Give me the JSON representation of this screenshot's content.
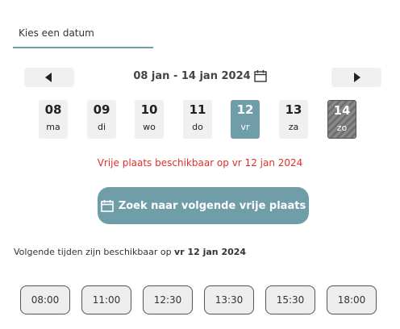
{
  "tab": {
    "label": "Kies een datum"
  },
  "week": {
    "range": "08 jan - 14 jan 2024"
  },
  "days": [
    {
      "num": "08",
      "weekday": "ma",
      "state": "normal"
    },
    {
      "num": "09",
      "weekday": "di",
      "state": "normal"
    },
    {
      "num": "10",
      "weekday": "wo",
      "state": "normal"
    },
    {
      "num": "11",
      "weekday": "do",
      "state": "normal"
    },
    {
      "num": "12",
      "weekday": "vr",
      "state": "selected"
    },
    {
      "num": "13",
      "weekday": "za",
      "state": "normal"
    },
    {
      "num": "14",
      "weekday": "zo",
      "state": "disabled"
    }
  ],
  "availability_message": "Vrije plaats beschikbaar op vr 12 jan 2024",
  "search_button": {
    "label": "Zoek naar volgende vrije plaats"
  },
  "next_times": {
    "prefix": "Volgende tijden zijn beschikbaar op ",
    "date": "vr 12 jan 2024"
  },
  "times": [
    "08:00",
    "11:00",
    "12:30",
    "13:30",
    "15:30",
    "18:00"
  ],
  "colors": {
    "accent": "#6f9ea8",
    "error": "#e0302a",
    "pill_bg": "#f0f0f0"
  },
  "icons": {
    "prev": "triangle-left-icon",
    "next": "triangle-right-icon",
    "calendar": "calendar-icon"
  }
}
